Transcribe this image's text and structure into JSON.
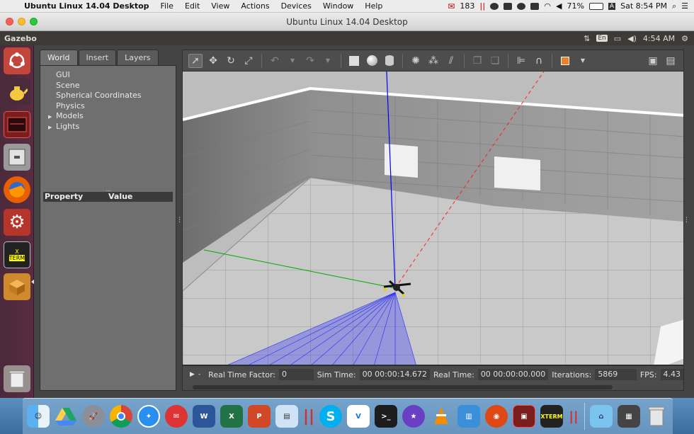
{
  "mac_menubar": {
    "app_name": "Ubuntu Linux 14.04 Desktop",
    "menus": [
      "File",
      "Edit",
      "View",
      "Actions",
      "Devices",
      "Window",
      "Help"
    ],
    "mail_count": "183",
    "battery": "71%",
    "input_letter": "A",
    "clock": "Sat 8:54 PM"
  },
  "window": {
    "title": "Ubuntu Linux 14.04 Desktop"
  },
  "ubuntu_panel": {
    "app_title": "Gazebo",
    "keyboard": "En",
    "time": "4:54 AM"
  },
  "left_panel": {
    "tabs": [
      "World",
      "Insert",
      "Layers"
    ],
    "tree": {
      "gui": "GUI",
      "scene": "Scene",
      "spherical": "Spherical Coordinates",
      "physics": "Physics",
      "models": "Models",
      "lights": "Lights"
    },
    "property_header": "Property",
    "value_header": "Value"
  },
  "status": {
    "rtf_label": "Real Time Factor:",
    "rtf_value": "0",
    "sim_label": "Sim Time:",
    "sim_value": "00 00:00:14.672",
    "real_label": "Real Time:",
    "real_value": "00 00:00:00.000",
    "iter_label": "Iterations:",
    "iter_value": "5869",
    "fps_label": "FPS:",
    "fps_value": "4.43"
  },
  "colors": {
    "ubuntu_launcher": "#5a2b42",
    "gazebo_panel": "#6f6f6f",
    "laser": "#1a1aff",
    "z_axis": "#0000ff",
    "y_axis": "#00aa00",
    "x_axis": "#ff0000",
    "record_red": "#d32f2f"
  }
}
